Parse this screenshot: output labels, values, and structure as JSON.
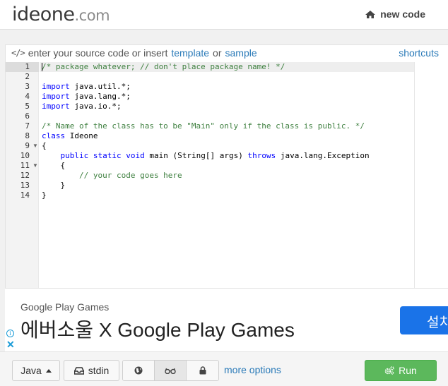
{
  "header": {
    "logo_main": "ideone",
    "logo_suffix": ".com",
    "new_code_label": "new code"
  },
  "editor_header": {
    "prefix": "enter your source code or insert",
    "template_link": "template",
    "or_text": "or",
    "sample_link": "sample",
    "shortcuts_link": "shortcuts"
  },
  "editor": {
    "line_numbers": [
      "1",
      "2",
      "3",
      "4",
      "5",
      "6",
      "7",
      "8",
      "9",
      "10",
      "11",
      "12",
      "13",
      "14"
    ],
    "active_line": 1,
    "code": {
      "l1": "/* package whatever; // don't place package name! */",
      "l3_kw": "import",
      "l3": " java.util.*;",
      "l4_kw": "import",
      "l4": " java.lang.*;",
      "l5_kw": "import",
      "l5": " java.io.*;",
      "l7": "/* Name of the class has to be \"Main\" only if the class is public. */",
      "l8_kw": "class",
      "l8": " Ideone",
      "l9": "{",
      "l10_indent": "    ",
      "l10_kw1": "public",
      "l10_kw2": "static",
      "l10_kw3": "void",
      "l10_a": " main (String[] args) ",
      "l10_kw4": "throws",
      "l10_b": " java.lang.Exception",
      "l11": "    {",
      "l12": "        // your code goes here",
      "l13": "    }",
      "l14": "}"
    }
  },
  "ad": {
    "advertiser": "Google Play Games",
    "headline": "에버소울 X Google Play Games",
    "button_label": "설치"
  },
  "toolbar": {
    "language": "Java",
    "stdin_label": "stdin",
    "more_options": "more options",
    "run_label": "Run"
  },
  "colors": {
    "link": "#2a7ab8",
    "keyword": "#0000ff",
    "comment": "#3f8040",
    "run_button": "#5cb85c",
    "ad_button": "#1a73e8"
  }
}
